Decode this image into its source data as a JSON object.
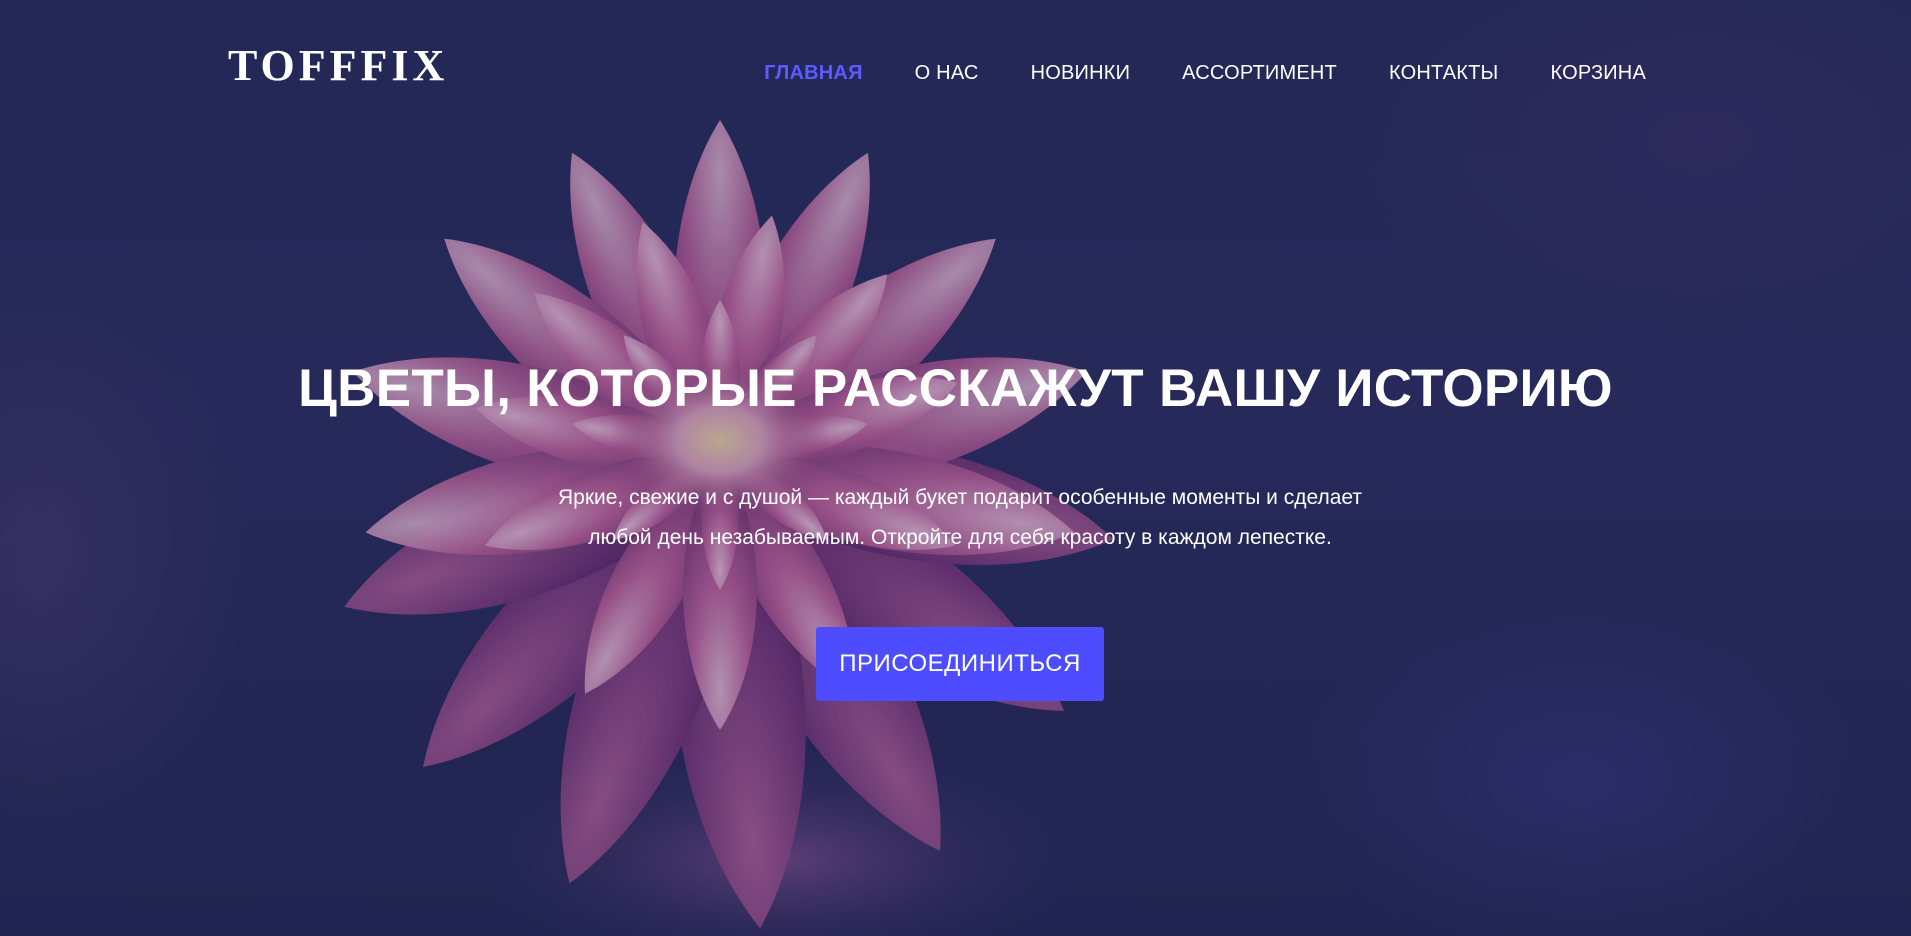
{
  "brand": {
    "logo": "TOFFFIX"
  },
  "nav": {
    "items": [
      {
        "label": "ГЛАВНАЯ",
        "active": true
      },
      {
        "label": "О НАС",
        "active": false
      },
      {
        "label": "НОВИНКИ",
        "active": false
      },
      {
        "label": "АССОРТИМЕНТ",
        "active": false
      },
      {
        "label": "КОНТАКТЫ",
        "active": false
      },
      {
        "label": "КОРЗИНА",
        "active": false
      }
    ]
  },
  "hero": {
    "title": "ЦВЕТЫ, КОТОРЫЕ РАССКАЖУТ ВАШУ ИСТОРИЮ",
    "subtitle_line1": "Яркие, свежие и с душой — каждый букет подарит особенные моменты и сделает",
    "subtitle_line2": "любой день незабываемым. Откройте для себя красоту в каждом лепестке.",
    "cta_label": "ПРИСОЕДИНИТЬСЯ",
    "background_image": "dahlia-flower-photo"
  },
  "colors": {
    "accent": "#4d4dff",
    "active_nav": "#5b5bff",
    "background": "#272c58",
    "text": "#ffffff"
  }
}
